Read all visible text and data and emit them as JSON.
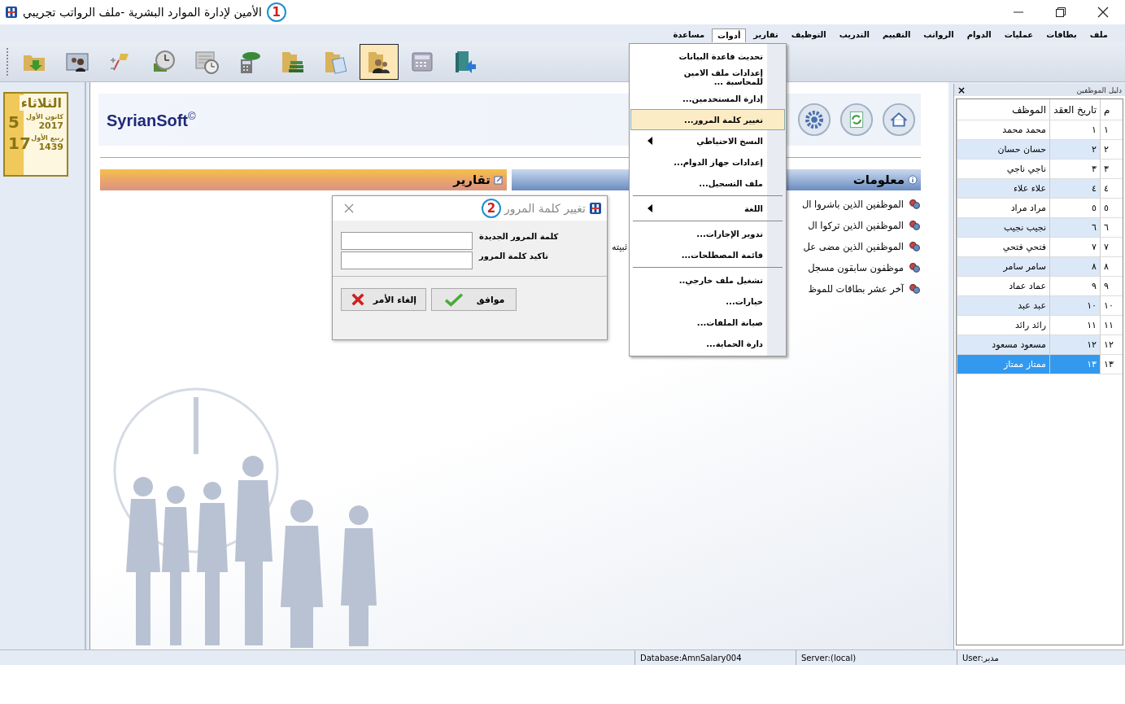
{
  "window": {
    "title": "الأمين لإدارة الموارد البشرية -ملف الرواتب تجريبي",
    "callout": "1"
  },
  "menu_bar": [
    {
      "label": "ملف",
      "selected": false
    },
    {
      "label": "بطاقات",
      "selected": false
    },
    {
      "label": "عمليات",
      "selected": false
    },
    {
      "label": "الدوام",
      "selected": false
    },
    {
      "label": "الرواتب",
      "selected": false
    },
    {
      "label": "التقييم",
      "selected": false
    },
    {
      "label": "التدريب",
      "selected": false
    },
    {
      "label": "التوظيف",
      "selected": false
    },
    {
      "label": "تقارير",
      "selected": false
    },
    {
      "label": "أدوات",
      "selected": true
    },
    {
      "label": "مساعدة",
      "selected": false
    }
  ],
  "toolbar": [
    {
      "selected": false
    },
    {
      "selected": false
    },
    {
      "selected": false
    },
    {
      "selected": false
    },
    {
      "selected": false
    },
    {
      "selected": false
    },
    {
      "selected": false
    },
    {
      "selected": false
    },
    {
      "selected": true
    },
    {
      "selected": false
    },
    {
      "selected": false
    }
  ],
  "date_panel": {
    "weekday": "الثلاثاء",
    "greg_day": "5",
    "greg_month": "كانون الأول",
    "greg_year": "2017",
    "hijri_day": "17",
    "hijri_month": "ربيع الأول",
    "hijri_year": "1439"
  },
  "header": {
    "brand": "SyrianSoft",
    "brand_mark": "©"
  },
  "reports_section": {
    "title": "تقارير"
  },
  "info_section": {
    "title": "معلومات",
    "items": [
      {
        "text": "الموظفين الذين باشروا ال"
      },
      {
        "text": "الموظفين الذين تركوا ال"
      },
      {
        "text": "الموظفين الذين مضى عل",
        "tail": "ثبيته"
      },
      {
        "text": "موظفون سابقون مسجل"
      },
      {
        "text": "آخر عشر بطاقات للموظ"
      }
    ]
  },
  "tools_menu": [
    {
      "kind": "item",
      "label": "تحديث قاعدة البيانات",
      "selected": false
    },
    {
      "kind": "item",
      "label": "إعدادات ملف الامين للمحاسبة ...",
      "selected": false
    },
    {
      "kind": "item",
      "label": "إدارة المستخدمين...",
      "selected": false
    },
    {
      "kind": "item",
      "label": "تغيير كلمة المرور...",
      "selected": true
    },
    {
      "kind": "submenu",
      "label": "النسخ الاحتياطي",
      "selected": false
    },
    {
      "kind": "item",
      "label": "إعدادات جهاز الدوام...",
      "selected": false
    },
    {
      "kind": "item",
      "label": "ملف التسجيل...",
      "selected": false
    },
    {
      "kind": "separator"
    },
    {
      "kind": "submenu",
      "label": "اللغة",
      "selected": false
    },
    {
      "kind": "separator"
    },
    {
      "kind": "item",
      "label": "تدوير الإجازات...",
      "selected": false
    },
    {
      "kind": "item",
      "label": "قائمة المصطلحات...",
      "selected": false
    },
    {
      "kind": "separator"
    },
    {
      "kind": "item",
      "label": "تشغيل ملف خارجي..",
      "selected": false
    },
    {
      "kind": "item",
      "label": "خيارات...",
      "selected": false
    },
    {
      "kind": "item",
      "label": "صيانة الملفات...",
      "selected": false
    },
    {
      "kind": "item",
      "label": "دارة الحماية...",
      "selected": false
    }
  ],
  "dialog": {
    "title": "تغيير كلمة المرور",
    "callout": "2",
    "fields": [
      {
        "label": "كلمة المرور الجديدة"
      },
      {
        "label": "تاكيد كلمة المرور"
      }
    ],
    "ok_button": "موافق",
    "cancel_button": "إلغاء الأمر"
  },
  "employees_panel": {
    "title": "دليل الموظفين",
    "close": "×",
    "columns": [
      "م",
      "تاريخ العقد",
      "الموظف"
    ],
    "rows": [
      {
        "num": "١",
        "date": "١",
        "name": "محمد محمد",
        "selected": false
      },
      {
        "num": "٢",
        "date": "٢",
        "name": "حسان حسان",
        "selected": false
      },
      {
        "num": "٣",
        "date": "٣",
        "name": "ناجي ناجي",
        "selected": false
      },
      {
        "num": "٤",
        "date": "٤",
        "name": "علاء علاء",
        "selected": false
      },
      {
        "num": "٥",
        "date": "٥",
        "name": "مراد مراد",
        "selected": false
      },
      {
        "num": "٦",
        "date": "٦",
        "name": "نجيب نجيب",
        "selected": false
      },
      {
        "num": "٧",
        "date": "٧",
        "name": "فتحي فتحي",
        "selected": false
      },
      {
        "num": "٨",
        "date": "٨",
        "name": "سامر سامر",
        "selected": false
      },
      {
        "num": "٩",
        "date": "٩",
        "name": "عماد عماد",
        "selected": false
      },
      {
        "num": "١٠",
        "date": "١٠",
        "name": "عبد عبد",
        "selected": false
      },
      {
        "num": "١١",
        "date": "١١",
        "name": "رائد رائد",
        "selected": false
      },
      {
        "num": "١٢",
        "date": "١٢",
        "name": "مسعود مسعود",
        "selected": false
      },
      {
        "num": "١٣",
        "date": "١٣",
        "name": "ممتاز ممتاز",
        "selected": true
      }
    ]
  },
  "status_bar": {
    "database": "Database:AmnSalary004",
    "server": "Server:(local)",
    "user": "User:مدير"
  }
}
